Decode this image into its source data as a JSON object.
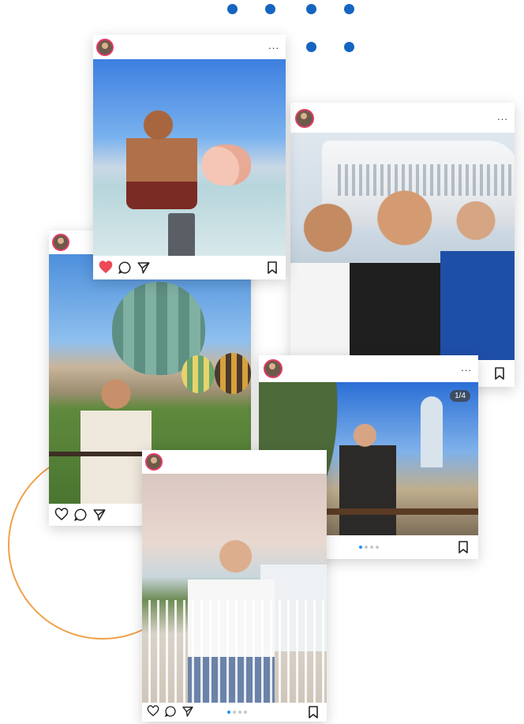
{
  "decor": {
    "dot_color": "#1565c0",
    "ring_color": "#f0a14a"
  },
  "posts": [
    {
      "id": "pig-beach",
      "more_label": "...",
      "liked": true,
      "like_color": "#ed4956",
      "icons": [
        "heart-icon",
        "comment-icon",
        "share-icon",
        "bookmark-icon"
      ]
    },
    {
      "id": "cruise-selfie",
      "more_label": "...",
      "liked": false,
      "icons": [
        "bookmark-icon"
      ]
    },
    {
      "id": "balloon-field",
      "liked": false,
      "icons": [
        "heart-icon",
        "comment-icon",
        "share-icon"
      ]
    },
    {
      "id": "palm-terrace",
      "more_label": "...",
      "counter": "1/4",
      "liked": false,
      "pager_active": 0,
      "pager_count": 4,
      "icons": [
        "heart-icon",
        "comment-icon",
        "share-icon",
        "bookmark-icon"
      ]
    },
    {
      "id": "hotel-balcony",
      "liked": false,
      "pager_active": 0,
      "pager_count": 4,
      "icons": [
        "heart-icon",
        "comment-icon",
        "share-icon",
        "bookmark-icon"
      ]
    }
  ]
}
